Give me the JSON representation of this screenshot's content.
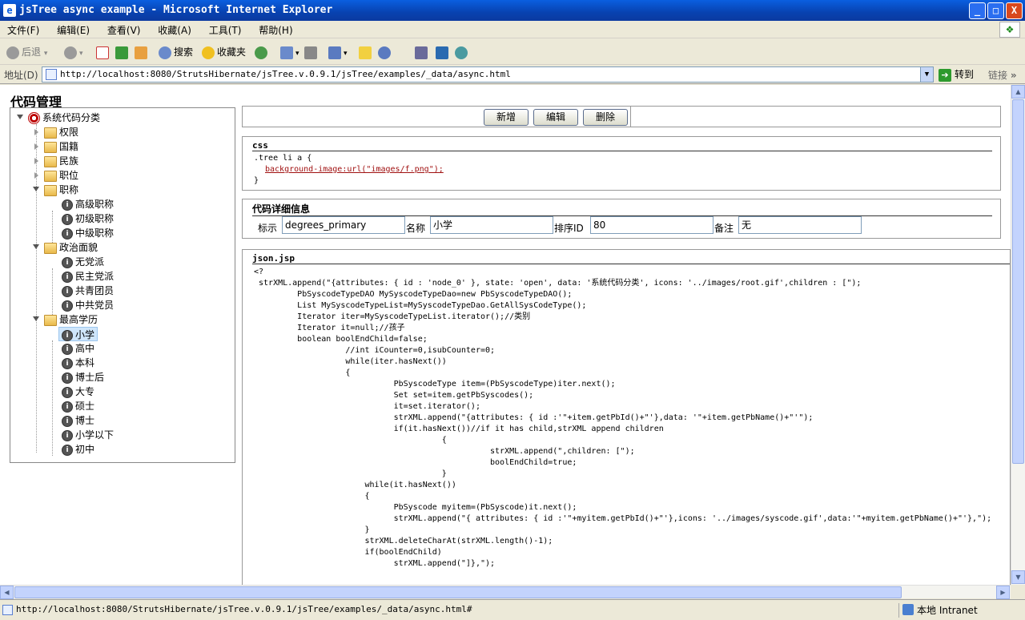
{
  "window": {
    "title": "jsTree async example - Microsoft Internet Explorer",
    "buttons": {
      "min": "_",
      "max": "□",
      "close": "X"
    }
  },
  "menu": [
    "文件(F)",
    "编辑(E)",
    "查看(V)",
    "收藏(A)",
    "工具(T)",
    "帮助(H)"
  ],
  "toolbar": {
    "back": "后退",
    "search": "搜索",
    "favorites": "收藏夹"
  },
  "address": {
    "label": "地址(D)",
    "url": "http://localhost:8080/StrutsHibernate/jsTree.v.0.9.1/jsTree/examples/_data/async.html",
    "go": "转到",
    "links": "链接"
  },
  "page": {
    "title": "代码管理",
    "tree": {
      "root": "系统代码分类",
      "items": [
        "权限",
        "国籍",
        "民族",
        "职位",
        "职称",
        "高级职称",
        "初级职称",
        "中级职称",
        "政治面貌",
        "无党派",
        "民主党派",
        "共青团员",
        "中共党员",
        "最高学历",
        "小学",
        "高中",
        "本科",
        "博士后",
        "大专",
        "硕士",
        "博士",
        "小学以下",
        "初中"
      ]
    },
    "buttons": {
      "add": "新增",
      "edit": "编辑",
      "delete": "删除"
    },
    "css_box": {
      "header": "css",
      "line1": ".tree li a {",
      "line2": "background-image:url(\"images/f.png\");",
      "line3": "}"
    },
    "detail": {
      "header": "代码详细信息",
      "id_label": "标示",
      "id_value": "degrees_primary",
      "name_label": "名称",
      "name_value": "小学",
      "order_label": "排序ID",
      "order_value": "80",
      "note_label": "备注",
      "note_value": "无"
    },
    "json_box": {
      "header": "json.jsp",
      "lines": [
        "<?",
        " strXML.append(\"{attributes: { id : 'node_0' }, state: 'open', data: '系统代码分类', icons: '../images/root.gif',children : [\");",
        "         PbSyscodeTypeDAO MySyscodeTypeDao=new PbSyscodeTypeDAO();",
        "         List MySyscodeTypeList=MySyscodeTypeDao.GetAllSysCodeType();",
        "         Iterator iter=MySyscodeTypeList.iterator();//类别",
        "         Iterator it=null;//孩子",
        "         boolean boolEndChild=false;",
        "                   //int iCounter=0,isubCounter=0;",
        "                   while(iter.hasNext())",
        "                   {",
        "                             PbSyscodeType item=(PbSyscodeType)iter.next();",
        "                             Set set=item.getPbSyscodes();",
        "                             it=set.iterator();",
        "                             strXML.append(\"{attributes: { id :'\"+item.getPbId()+\"'},data: '\"+item.getPbName()+\"'\");",
        "",
        "                             if(it.hasNext())//if it has child,strXML append children",
        "                                       {",
        "                                                 strXML.append(\",children: [\");",
        "                                                 boolEndChild=true;",
        "                                       }",
        "                       while(it.hasNext())",
        "                       {",
        "                             PbSyscode myitem=(PbSyscode)it.next();",
        "                             strXML.append(\"{ attributes: { id :'\"+myitem.getPbId()+\"'},icons: '../images/syscode.gif',data:'\"+myitem.getPbName()+\"'},\");",
        "                       }",
        "                       strXML.deleteCharAt(strXML.length()-1);",
        "                       if(boolEndChild)",
        "                             strXML.append(\"]},\");"
      ]
    }
  },
  "status": {
    "url": "http://localhost:8080/StrutsHibernate/jsTree.v.0.9.1/jsTree/examples/_data/async.html#",
    "zone": "本地 Intranet"
  },
  "colors": {
    "titlebar": "#0842b0",
    "chrome": "#ece9d8",
    "selected_node": "#cfe6fb",
    "css_red": "#a01010"
  }
}
